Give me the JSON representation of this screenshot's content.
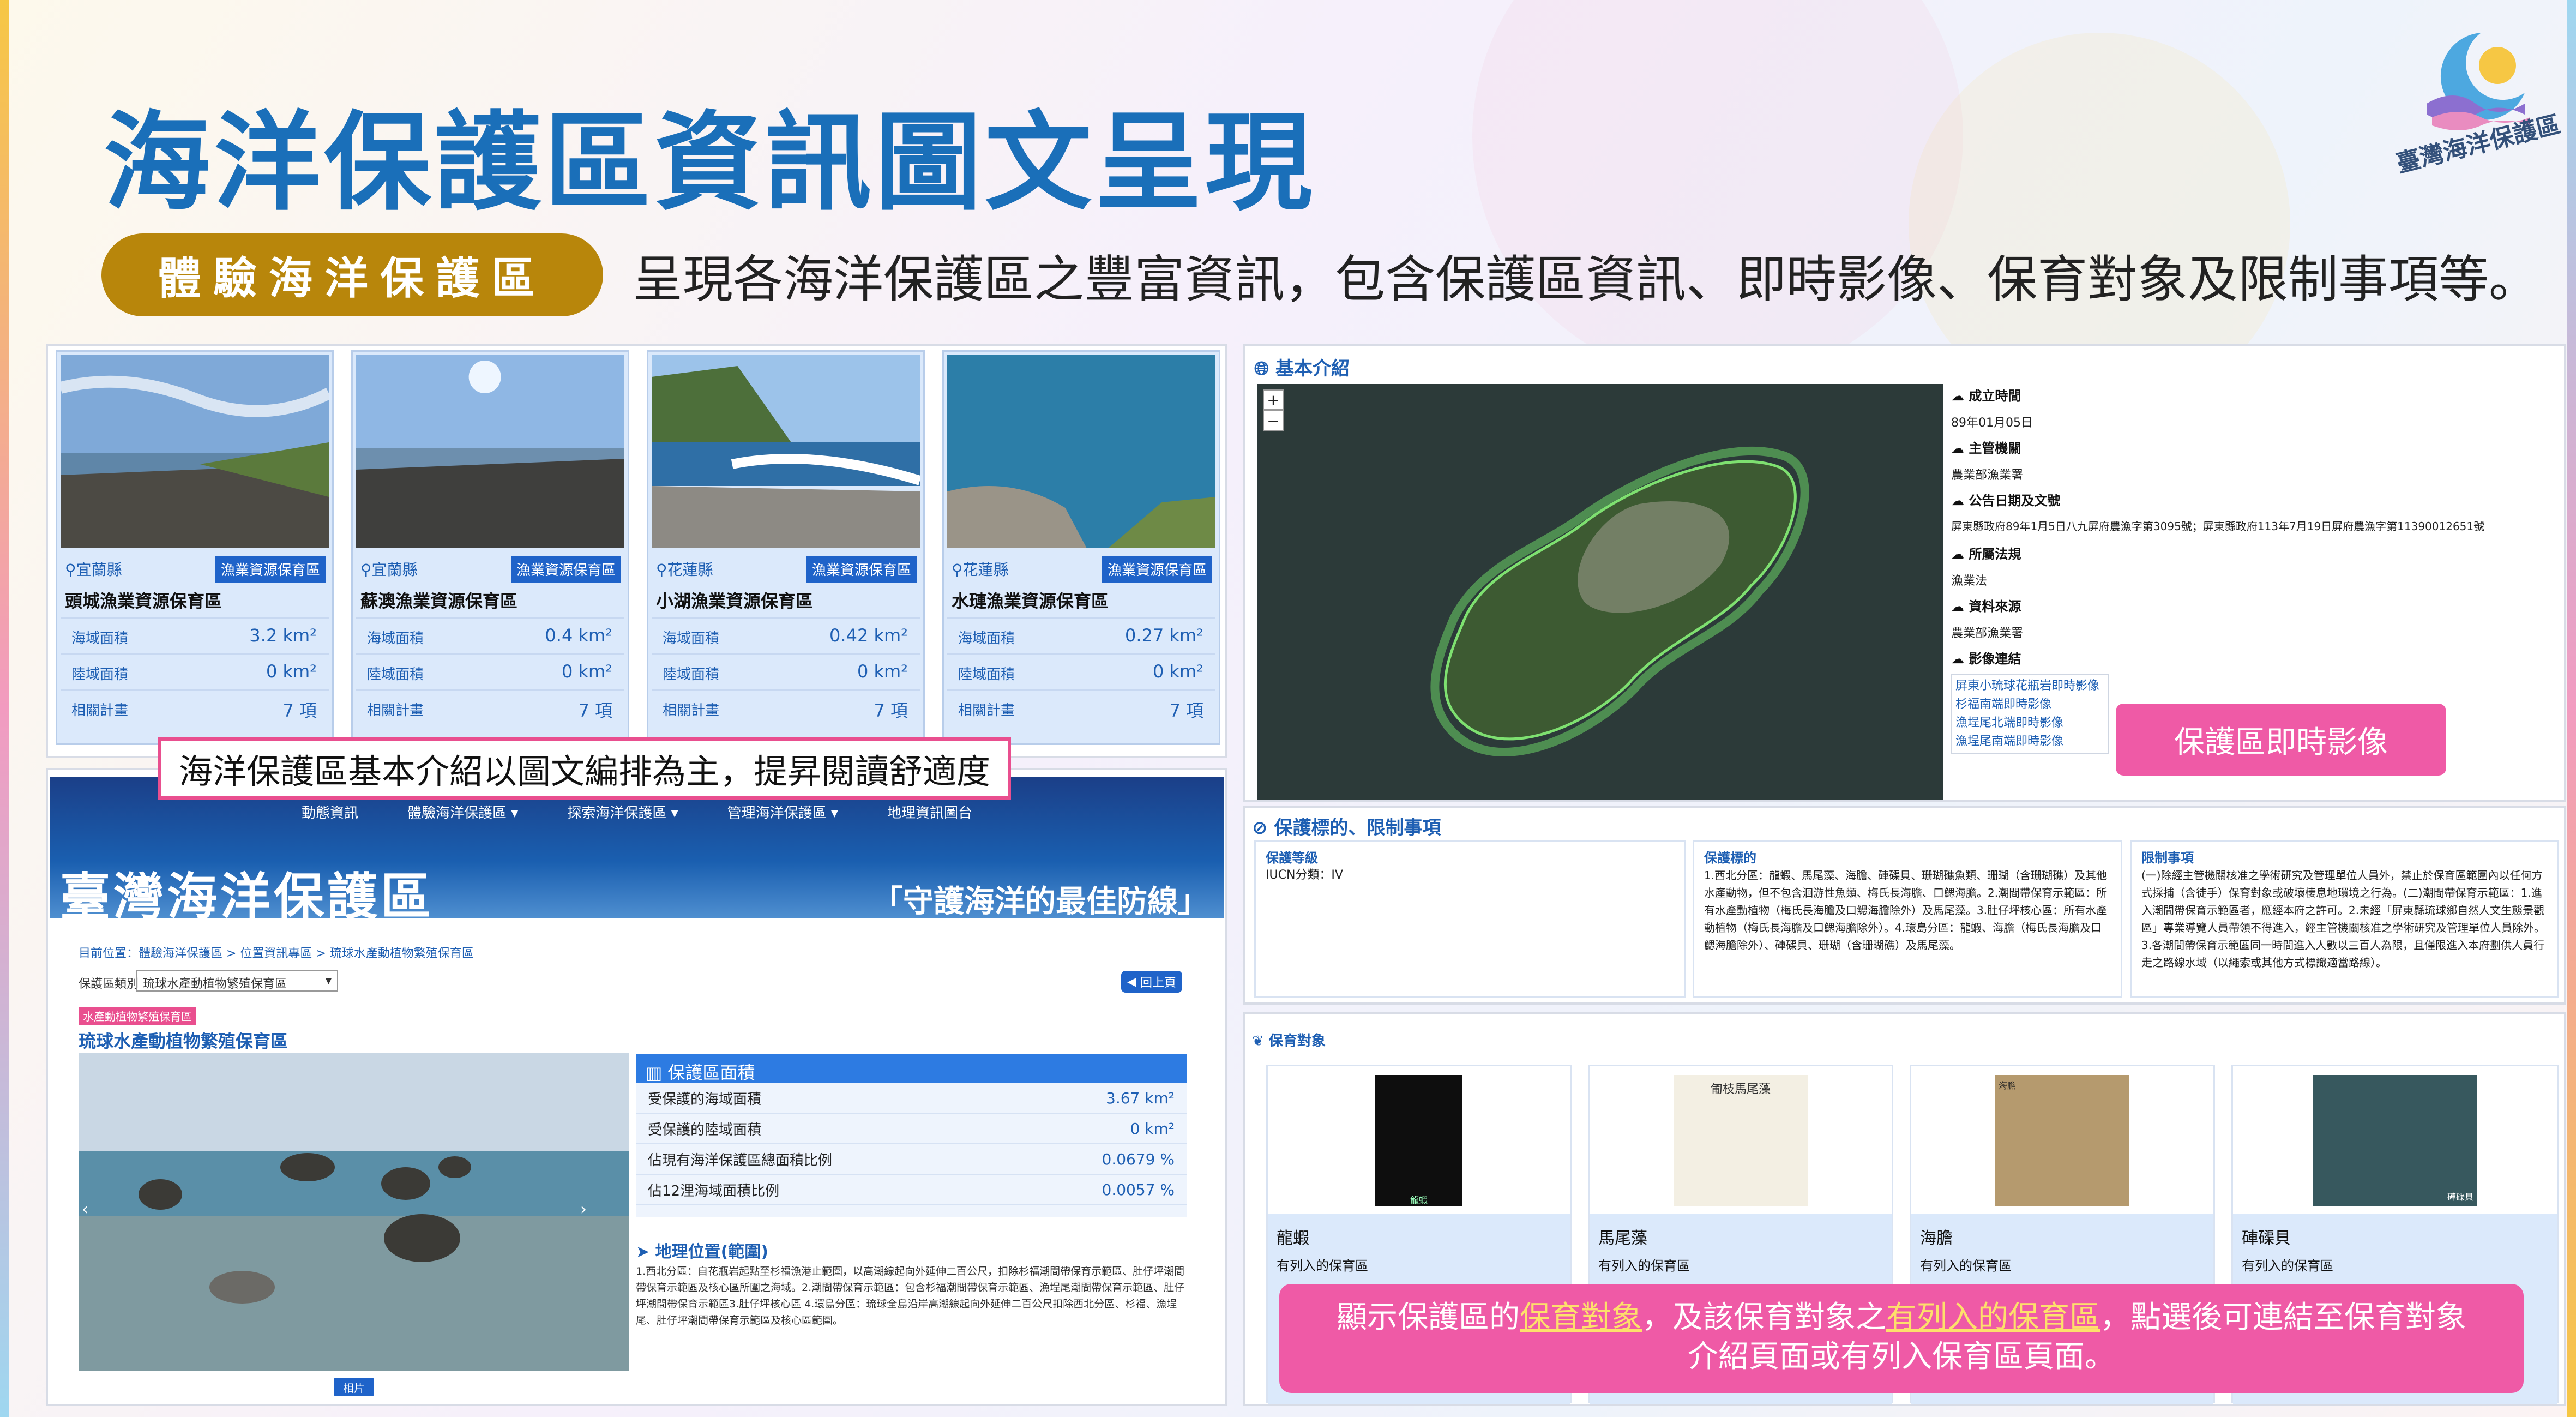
{
  "header": {
    "title": "海洋保護區資訊圖文呈現",
    "pill_label": "體驗海洋保護區",
    "subtitle": "呈現各海洋保護區之豐富資訊，包含保護區資訊、即時影像、保育對象及限制事項等。",
    "logo_text": "臺灣海洋保護區"
  },
  "cards": [
    {
      "county": "宜蘭縣",
      "badge": "漁業資源保育區",
      "name": "頭城漁業資源保育區",
      "sea_label": "海域面積",
      "sea_value": "3.2 km²",
      "land_label": "陸域面積",
      "land_value": "0 km²",
      "plan_label": "相關計畫",
      "plan_value": "7 項"
    },
    {
      "county": "宜蘭縣",
      "badge": "漁業資源保育區",
      "name": "蘇澳漁業資源保育區",
      "sea_label": "海域面積",
      "sea_value": "0.4 km²",
      "land_label": "陸域面積",
      "land_value": "0 km²",
      "plan_label": "相關計畫",
      "plan_value": "7 項"
    },
    {
      "county": "花蓮縣",
      "badge": "漁業資源保育區",
      "name": "小湖漁業資源保育區",
      "sea_label": "海域面積",
      "sea_value": "0.42 km²",
      "land_label": "陸域面積",
      "land_value": "0 km²",
      "plan_label": "相關計畫",
      "plan_value": "7 項"
    },
    {
      "county": "花蓮縣",
      "badge": "漁業資源保育區",
      "name": "水璉漁業資源保育區",
      "sea_label": "海域面積",
      "sea_value": "0.27 km²",
      "land_label": "陸域面積",
      "land_value": "0 km²",
      "plan_label": "相關計畫",
      "plan_value": "7 項"
    }
  ],
  "callout_left": "海洋保護區基本介紹以圖文編排為主，提昇閱讀舒適度",
  "site": {
    "nav": [
      "動態資訊",
      "體驗海洋保護區 ▾",
      "探索海洋保護區 ▾",
      "管理海洋保護區 ▾",
      "地理資訊圖台"
    ],
    "logo": "臺灣海洋保護區",
    "slogan": "「守護海洋的最佳防線」",
    "breadcrumb": "目前位置：體驗海洋保護區 > 位置資訊專區 > 琉球水產動植物繁殖保育區",
    "select_label": "保護區類別",
    "select_value": "琉球水產動植物繁殖保育區",
    "back_button": "回上頁",
    "tag": "水產動植物繁殖保育區",
    "area_name": "琉球水產動植物繁殖保育區",
    "photo_button": "相片",
    "area_box": {
      "heading": "保護區面積",
      "rows": [
        {
          "k": "受保護的海域面積",
          "v": "3.67 km²"
        },
        {
          "k": "受保護的陸域面積",
          "v": "0 km²"
        },
        {
          "k": "佔現有海洋保護區總面積比例",
          "v": "0.0679 %"
        },
        {
          "k": "佔12浬海域面積比例",
          "v": "0.0057 %"
        }
      ]
    },
    "geo_heading": "地理位置(範圍)",
    "geo_text": "1.西北分區：自花瓶岩起點至杉福漁港止範圍，以高潮線起向外延伸二百公尺，扣除杉福潮間帶保育示範區、肚仔坪潮間帶保育示範區及核心區所圍之海域。2.潮間帶保育示範區：包含杉福潮間帶保育示範區、漁埕尾潮間帶保育示範區、肚仔坪潮間帶保育示範區3.肚仔坪核心區 4.環島分區：琉球全島沿岸高潮線起向外延伸二百公尺扣除西北分區、杉福、漁埕尾、肚仔坪潮間帶保育示範區及核心區範圍。"
  },
  "intro": {
    "title": "基本介紹",
    "zoom_in": "+",
    "zoom_out": "−",
    "fields": [
      {
        "k": "成立時間",
        "v": "89年01月05日"
      },
      {
        "k": "主管機關",
        "v": "農業部漁業署"
      },
      {
        "k": "公告日期及文號",
        "v": "屏東縣政府89年1月5日八九屏府農漁字第3095號；屏東縣政府113年7月19日屏府農漁字第11390012651號"
      },
      {
        "k": "所屬法規",
        "v": "漁業法"
      },
      {
        "k": "資料來源",
        "v": "農業部漁業署"
      }
    ],
    "links_label": "影像連結",
    "links": [
      "屏東小琉球花瓶岩即時影像",
      "杉福南端即時影像",
      "漁埕尾北端即時影像",
      "漁埕尾南端即時影像"
    ],
    "callout": "保護區即時影像"
  },
  "restrict": {
    "title": "保護標的、限制事項",
    "col1_title": "保護等級",
    "col1_text": "IUCN分類：IV",
    "col2_title": "保護標的",
    "col2_text": "1.西北分區：龍蝦、馬尾藻、海膽、硨磲貝、珊瑚礁魚類、珊瑚（含珊瑚礁）及其他水產動物，但不包含洄游性魚類、梅氏長海膽、口鰓海膽。2.潮間帶保育示範區：所有水產動植物（梅氏長海膽及口鰓海膽除外）及馬尾藻。3.肚仔坪核心區：所有水產動植物（梅氏長海膽及口鰓海膽除外）。4.環島分區：龍蝦、海膽（梅氏長海膽及口鰓海膽除外）、硨磲貝、珊瑚（含珊瑚礁）及馬尾藻。",
    "col3_title": "限制事項",
    "col3_text": "(一)除經主管機關核准之學術研究及管理單位人員外，禁止於保育區範圍內以任何方式採捕（含徒手）保育對象或破壞棲息地環境之行為。(二)潮間帶保育示範區：1.進入潮間帶保育示範區者，應經本府之許可。2.未經「屏東縣琉球鄉自然人文生態景觀區」專業導覽人員帶領不得進入，經主管機關核准之學術研究及管理單位人員除外。3.各潮間帶保育示範區同一時間進入人數以三百人為限，且僅限進入本府劃供人員行走之路線水域（以繩索或其他方式標識適當路線）。"
  },
  "species": {
    "title": "保育對象",
    "items": [
      {
        "name": "龍蝦",
        "level": "有列入的保育區",
        "img_caption": "龍蝦"
      },
      {
        "name": "馬尾藻",
        "level": "有列入的保育區",
        "img_caption": "匍枝馬尾藻"
      },
      {
        "name": "海膽",
        "level": "有列入的保育區",
        "img_caption": "海膽"
      },
      {
        "name": "硨磲貝",
        "level": "有列入的保育區",
        "img_caption": "硨磲貝"
      }
    ],
    "callout_parts": [
      "顯示保護區的",
      "保育對象",
      "，及該保育對象之",
      "有列入的保育區",
      "，點選後可連結至保育對象",
      "介紹頁面或有列入保育區頁面。"
    ]
  }
}
